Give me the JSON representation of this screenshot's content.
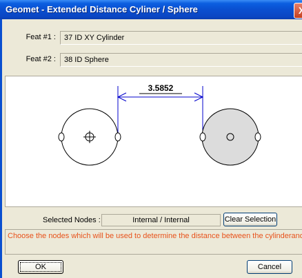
{
  "window": {
    "title": "Geomet - Extended Distance Cyliner / Sphere",
    "close_glyph": "X"
  },
  "feat1": {
    "label": "Feat #1 :",
    "value": "37 ID XY Cylinder"
  },
  "feat2": {
    "label": "Feat #2 :",
    "value": "38 ID Sphere"
  },
  "canvas": {
    "distance": "3.5852"
  },
  "selected": {
    "label": "Selected Nodes :",
    "value": "Internal / Internal",
    "clear_label": "Clear Selection"
  },
  "message": "Choose the nodes which will be used to determine the distance between the cylinderand sphere.",
  "buttons": {
    "ok": "OK",
    "cancel": "Cancel"
  },
  "colors": {
    "accent": "#0a4fd0",
    "dimension": "#0000cc",
    "message": "#e8521b",
    "sphere_fill": "#dcdcdc"
  }
}
